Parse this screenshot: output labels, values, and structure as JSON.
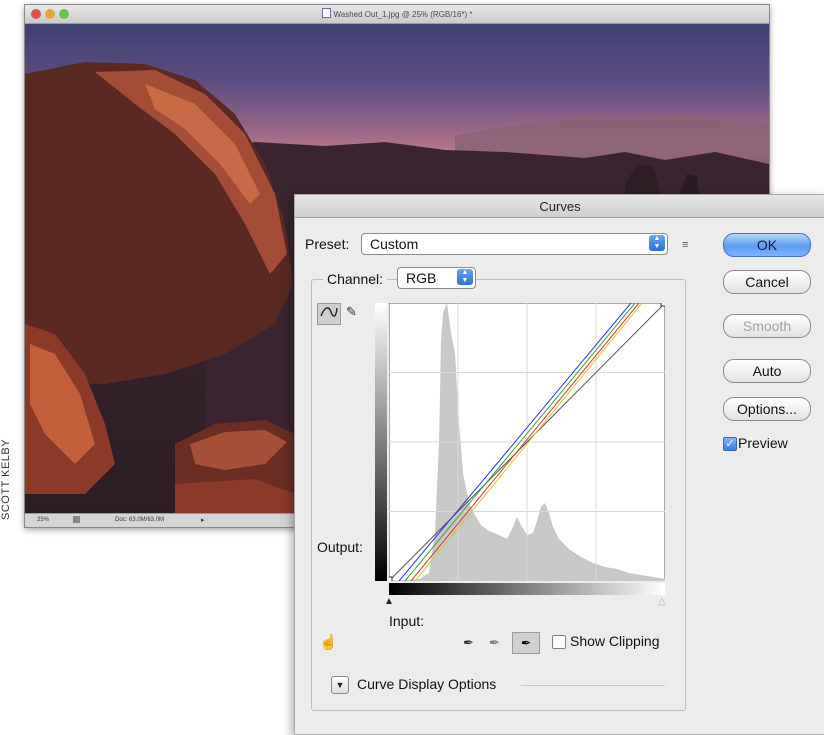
{
  "document_window": {
    "title": "Washed Out_1.jpg @ 25% (RGB/16*) *",
    "zoom": "25%",
    "doc_info": "Doc: 63.0M/63.0M",
    "status_arrow": "▸"
  },
  "credit": "SCOTT KELBY",
  "curves_dialog": {
    "title": "Curves",
    "preset_label": "Preset:",
    "preset_value": "Custom",
    "preset_menu_icon": "≡",
    "channel_label": "Channel:",
    "channel_value": "RGB",
    "output_label": "Output:",
    "input_label": "Input:",
    "show_clipping_label": "Show Clipping",
    "curve_display_options_label": "Curve Display Options",
    "buttons": {
      "ok": "OK",
      "cancel": "Cancel",
      "smooth": "Smooth",
      "auto": "Auto",
      "options": "Options..."
    },
    "preview_label": "Preview",
    "preview_checked": true,
    "show_clipping_checked": false,
    "icons": {
      "curve_edit": "curve-wave-icon",
      "pencil": "pencil-icon",
      "hand": "on-image-adjust-icon",
      "black_eyedropper": "eyedropper-black-icon",
      "gray_eyedropper": "eyedropper-gray-icon",
      "white_eyedropper": "eyedropper-white-icon"
    },
    "accent_color": "#3a7fe0"
  }
}
